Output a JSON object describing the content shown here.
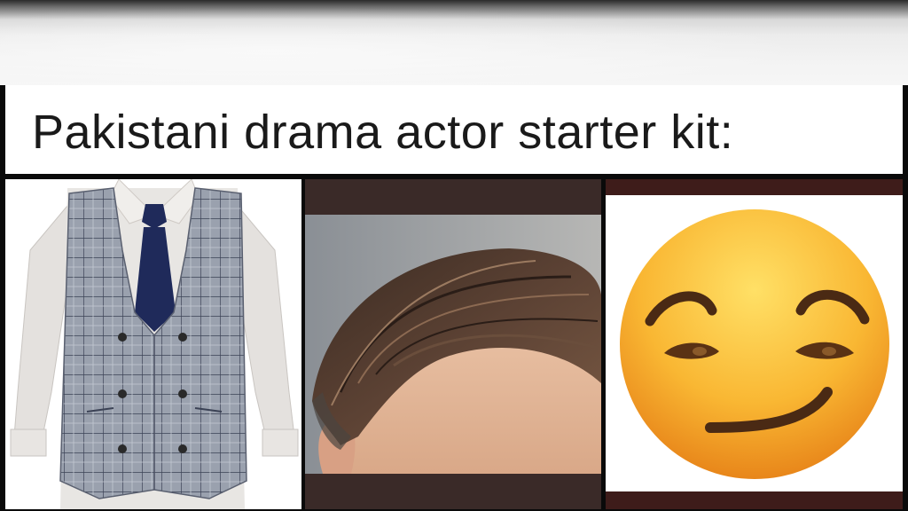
{
  "meme": {
    "caption": "Pakistani drama actor starter kit:"
  },
  "panels": [
    {
      "icon": "waistcoat-shirt-tie-icon"
    },
    {
      "icon": "slicked-hair-icon"
    },
    {
      "icon": "smirking-face-emoji-icon"
    }
  ],
  "colors": {
    "waistcoat": "#8e95a3",
    "tie": "#1f2a5a",
    "hair": "#4a3528",
    "emoji": "#f6b12d"
  }
}
